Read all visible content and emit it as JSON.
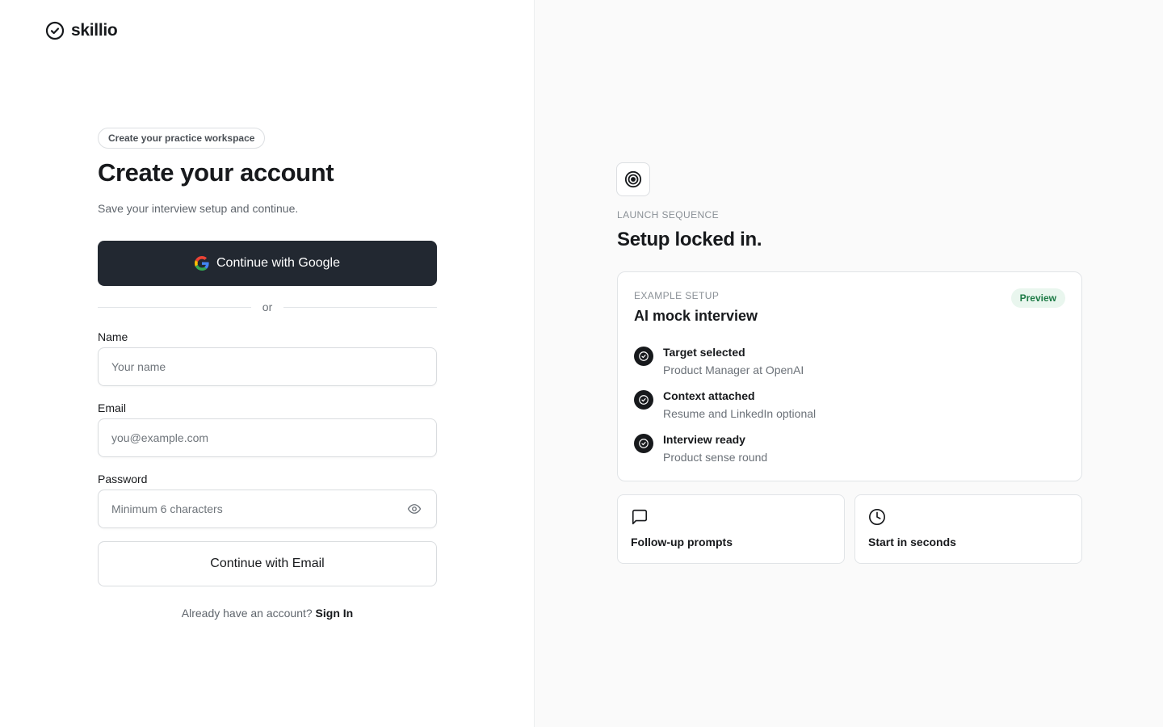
{
  "brand": {
    "name": "skillio"
  },
  "signup": {
    "pill": "Create your practice workspace",
    "title": "Create your account",
    "subtitle": "Save your interview setup and continue.",
    "google_label": "Continue with Google",
    "divider": "or",
    "name": {
      "label": "Name",
      "placeholder": "Your name",
      "value": ""
    },
    "email": {
      "label": "Email",
      "placeholder": "you@example.com",
      "value": ""
    },
    "password": {
      "label": "Password",
      "placeholder": "Minimum 6 characters",
      "value": ""
    },
    "email_button": "Continue with Email",
    "signin_prompt": "Already have an account?",
    "signin_link": "Sign In"
  },
  "preview": {
    "eyebrow": "LAUNCH SEQUENCE",
    "title": "Setup locked in.",
    "card": {
      "eyebrow": "EXAMPLE SETUP",
      "title": "AI mock interview",
      "badge": "Preview",
      "steps": [
        {
          "title": "Target selected",
          "desc": "Product Manager at OpenAI"
        },
        {
          "title": "Context attached",
          "desc": "Resume and LinkedIn optional"
        },
        {
          "title": "Interview ready",
          "desc": "Product sense round"
        }
      ]
    },
    "tiles": [
      {
        "icon": "message-square-icon",
        "label": "Follow-up prompts"
      },
      {
        "icon": "clock-icon",
        "label": "Start in seconds"
      }
    ]
  },
  "colors": {
    "primary_button": "#222831",
    "badge_bg": "#e9f6ee",
    "badge_text": "#1c7a45",
    "panel_bg": "#fafafa"
  }
}
